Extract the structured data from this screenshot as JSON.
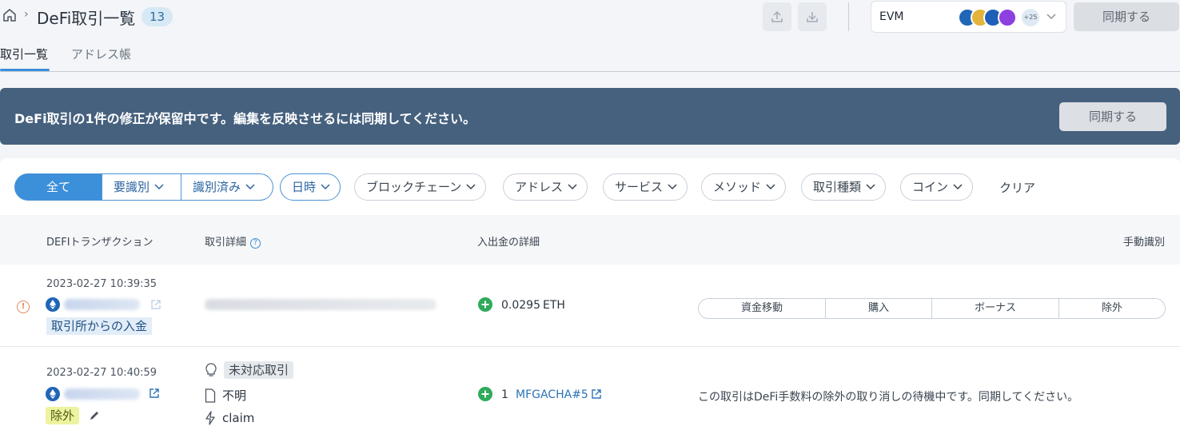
{
  "header": {
    "title": "DeFi取引一覧",
    "count": "13",
    "chain_select": {
      "label": "EVM",
      "more_badge": "+25"
    },
    "sync_label": "同期する"
  },
  "tabs": [
    {
      "label": "取引一覧",
      "active": true
    },
    {
      "label": "アドレス帳",
      "active": false
    }
  ],
  "banner": {
    "text": "DeFi取引の1件の修正が保留中です。編集を反映させるには同期してください。",
    "button": "同期する"
  },
  "filters": {
    "segment": [
      "全て",
      "要識別",
      "識別済み"
    ],
    "pills": [
      "日時",
      "ブロックチェーン",
      "アドレス",
      "サービス",
      "メソッド",
      "取引種類",
      "コイン"
    ],
    "clear": "クリア"
  },
  "table": {
    "headers": [
      "DEFIトランザクション",
      "取引詳細",
      "入出金の詳細",
      "手動識別"
    ],
    "rows": [
      {
        "timestamp": "2023-02-27 10:39:35",
        "tag": "取引所からの入金",
        "amount": "0.0295",
        "coin": "ETH",
        "actions": [
          "資金移動",
          "購入",
          "ボーナス",
          "除外"
        ]
      },
      {
        "timestamp": "2023-02-27 10:40:59",
        "tag": "除外",
        "details": {
          "status": "未対応取引",
          "doc": "不明",
          "method": "claim"
        },
        "amount": "1",
        "coin": "MFGACHA#5",
        "note": "この取引はDeFi手数料の除外の取り消しの待機中です。同期してください。"
      }
    ]
  },
  "colors": {
    "accent": "#3c8fd9",
    "banner": "#46617e",
    "incoming": "#2eaa5b",
    "warning": "#e08a55",
    "excluded_tag": "#eef3a0"
  }
}
